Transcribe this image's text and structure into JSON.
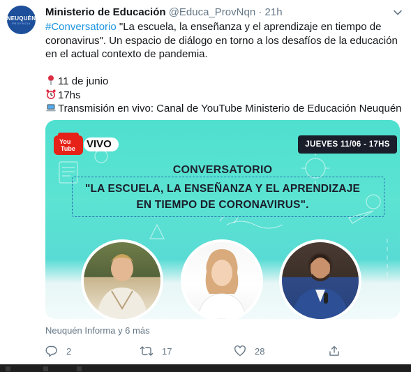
{
  "tweet": {
    "avatar": {
      "text": "NEUQUÉN",
      "sub": "PROVINCIA"
    },
    "name": "Ministerio de Educación",
    "handle": "@Educa_ProvNqn",
    "separator": "·",
    "time": "21h",
    "more_icon": "chevron-down-icon",
    "text": {
      "hashtag": "#Conversatorio",
      "line1_rest": " \"La escuela, la enseñanza y el aprendizaje en tiempo de",
      "line2": "coronavirus\". Un espacio de diálogo en torno a los desafíos de la educación",
      "line3": "en el actual contexto de pandemia.",
      "date": "11 de junio",
      "hour": "17hs",
      "stream": "Transmisión en vivo: Canal de YouTube Ministerio de Educación Neuquén"
    },
    "card": {
      "yt_line1": "You",
      "yt_line2": "Tube",
      "vivo": "VIVO",
      "date_badge": "JUEVES 11/06 - 17HS",
      "title": "CONVERSATORIO",
      "quote_line1": "\"LA ESCUELA, LA ENSEÑANZA Y EL APRENDIZAJE",
      "quote_line2": "EN TIEMPO DE CORONAVIRUS\"."
    },
    "credits": "Neuquén Informa y 6 más",
    "actions": {
      "replies": "2",
      "retweets": "17",
      "likes": "28"
    }
  },
  "colors": {
    "link": "#1b95e0",
    "muted": "#657786",
    "card_teal": "#4fe0cf"
  }
}
